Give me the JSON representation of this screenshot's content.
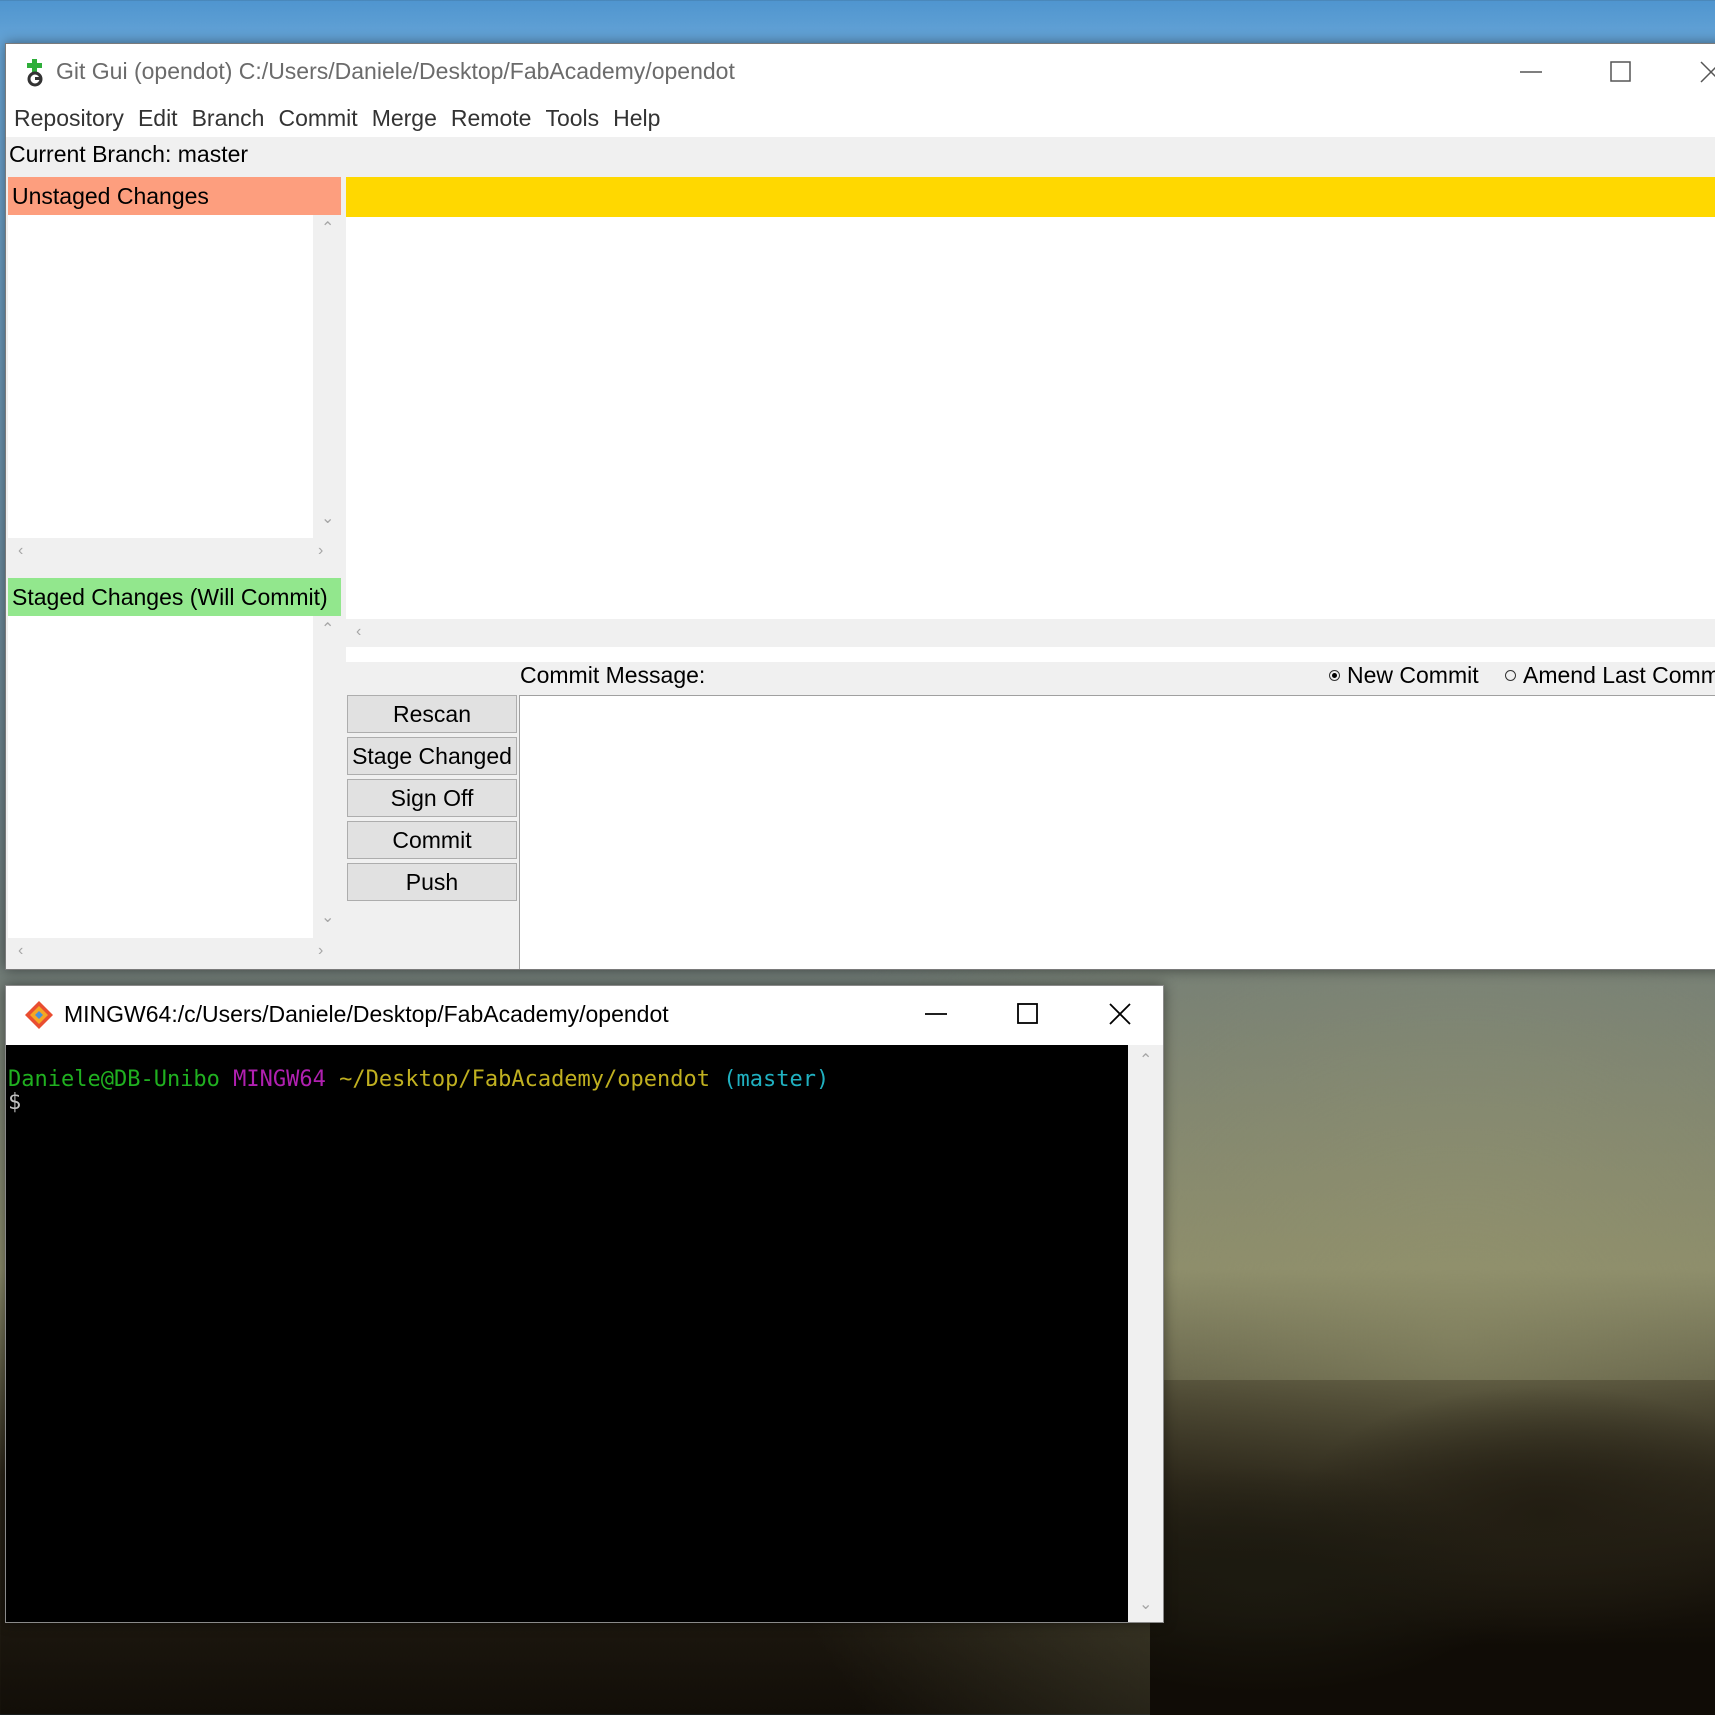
{
  "gitgui": {
    "title": "Git Gui (opendot) C:/Users/Daniele/Desktop/FabAcademy/opendot",
    "menu": [
      "Repository",
      "Edit",
      "Branch",
      "Commit",
      "Merge",
      "Remote",
      "Tools",
      "Help"
    ],
    "current_branch": "Current Branch: master",
    "unstaged_header": "Unstaged Changes",
    "staged_header": "Staged Changes (Will Commit)",
    "commit_message_label": "Commit Message:",
    "radio_new": "New Commit",
    "radio_amend": "Amend Last Comm",
    "buttons": [
      "Rescan",
      "Stage Changed",
      "Sign Off",
      "Commit",
      "Push"
    ],
    "colors": {
      "unstaged": "#fd9e7e",
      "staged": "#92e78d",
      "diff_header": "#ffd800"
    }
  },
  "mingw": {
    "title": "MINGW64:/c/Users/Daniele/Desktop/FabAcademy/opendot",
    "prompt_user": "Daniele@DB-Unibo",
    "prompt_env": "MINGW64",
    "prompt_path": "~/Desktop/FabAcademy/opendot",
    "prompt_branch": "(master)",
    "prompt_symbol": "$"
  }
}
